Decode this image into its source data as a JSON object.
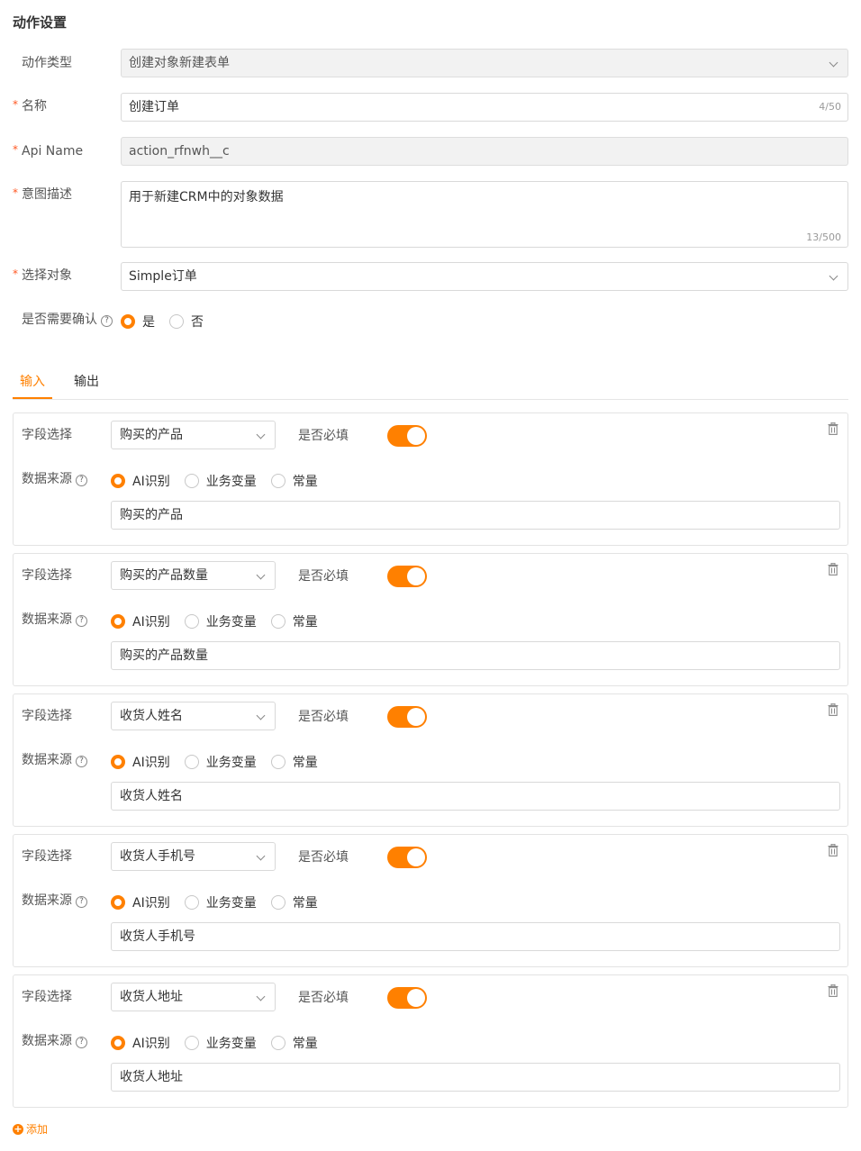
{
  "section_title": "动作设置",
  "action_type": {
    "label": "动作类型",
    "value": "创建对象新建表单"
  },
  "name": {
    "label": "名称",
    "value": "创建订单",
    "counter": "4/50"
  },
  "api_name": {
    "label": "Api Name",
    "value": "action_rfnwh__c"
  },
  "intent": {
    "label": "意图描述",
    "value": "用于新建CRM中的对象数据",
    "counter": "13/500"
  },
  "object": {
    "label": "选择对象",
    "value": "Simple订单"
  },
  "confirm": {
    "label": "是否需要确认",
    "help": "?",
    "options": [
      "是",
      "否"
    ],
    "selected": "是"
  },
  "tabs": [
    {
      "label": "输入",
      "active": true
    },
    {
      "label": "输出",
      "active": false
    }
  ],
  "card_labels": {
    "field_select": "字段选择",
    "required": "是否必填",
    "data_source": "数据来源",
    "help": "?",
    "source_options": [
      "AI识别",
      "业务变量",
      "常量"
    ]
  },
  "fields": [
    {
      "field": "购买的产品",
      "required": true,
      "source": "AI识别",
      "value": "购买的产品"
    },
    {
      "field": "购买的产品数量",
      "required": true,
      "source": "AI识别",
      "value": "购买的产品数量"
    },
    {
      "field": "收货人姓名",
      "required": true,
      "source": "AI识别",
      "value": "收货人姓名"
    },
    {
      "field": "收货人手机号",
      "required": true,
      "source": "AI识别",
      "value": "收货人手机号"
    },
    {
      "field": "收货人地址",
      "required": true,
      "source": "AI识别",
      "value": "收货人地址"
    }
  ],
  "add_label": "添加",
  "colors": {
    "accent": "#ff8000",
    "required_star": "#ff5722",
    "disabled_bg": "#f2f2f2"
  },
  "icons": {
    "trash": "trash-icon",
    "help": "help-circle-icon",
    "chevron": "chevron-down-icon",
    "add": "plus-circle-icon"
  }
}
